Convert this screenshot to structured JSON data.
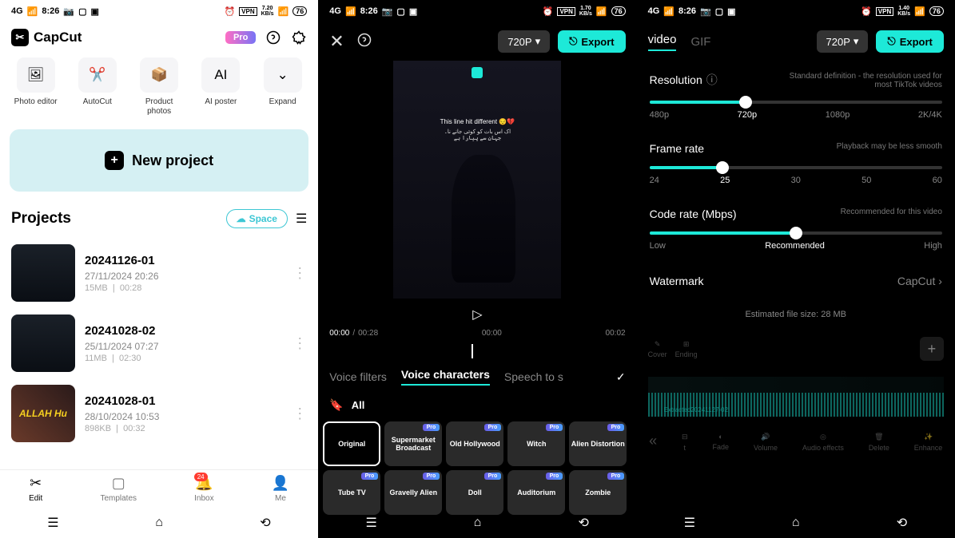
{
  "statusbar": {
    "time": "8:26",
    "signal": "4G",
    "speed1": "7.20",
    "speed2": "1.70",
    "speed3": "1.40",
    "unit": "KB/s",
    "batt": "76",
    "vpn": "VPN"
  },
  "s1": {
    "logo": "CapCut",
    "pro": "Pro",
    "tools": [
      "Photo editor",
      "AutoCut",
      "Product photos",
      "AI poster",
      "Expand"
    ],
    "newproject": "New project",
    "projectstitle": "Projects",
    "space": "Space",
    "projects": [
      {
        "t": "20241126-01",
        "d": "27/11/2024 20:26",
        "s": "15MB",
        "du": "00:28"
      },
      {
        "t": "20241028-02",
        "d": "25/11/2024 07:27",
        "s": "11MB",
        "du": "02:30"
      },
      {
        "t": "20241028-01",
        "d": "28/10/2024 10:53",
        "s": "898KB",
        "du": "00:32",
        "thumb": "ALLAH Hu"
      }
    ],
    "nav": [
      "Edit",
      "Templates",
      "Inbox",
      "Me"
    ],
    "badge": "24"
  },
  "s2": {
    "res": "720P",
    "export": "Export",
    "previewtext": "This line hit different 😔💔",
    "previewtext2": "اک اس بات کو کوئی جانے نا۔\nجہان سے پیارا ہے",
    "tTotal": "00:28",
    "tCur": "00:00",
    "t1": "00:00",
    "t2": "00:02",
    "tabs": [
      "Voice filters",
      "Voice characters",
      "Speech to s"
    ],
    "activetab": 1,
    "all": "All",
    "voices": [
      {
        "n": "Original",
        "sel": true
      },
      {
        "n": "Supermarket Broadcast",
        "pro": true
      },
      {
        "n": "Old Hollywood",
        "pro": true
      },
      {
        "n": "Witch",
        "pro": true
      },
      {
        "n": "Alien Distortion",
        "pro": true
      },
      {
        "n": "Tube TV",
        "pro": true
      },
      {
        "n": "Gravelly Alien",
        "pro": true
      },
      {
        "n": "Doll",
        "pro": true
      },
      {
        "n": "Auditorium",
        "pro": true
      },
      {
        "n": "Zombie",
        "pro": true
      }
    ]
  },
  "s3": {
    "tabvideo": "video",
    "tabgif": "GIF",
    "res": "720P",
    "export": "Export",
    "resolution": {
      "label": "Resolution",
      "desc": "Standard definition - the resolution used for most TikTok videos",
      "opts": [
        "480p",
        "720p",
        "1080p",
        "2K/4K"
      ],
      "pos": 33
    },
    "framerate": {
      "label": "Frame rate",
      "desc": "Playback may be less smooth",
      "opts": [
        "24",
        "25",
        "30",
        "50",
        "60"
      ],
      "pos": 25
    },
    "coderate": {
      "label": "Code rate (Mbps)",
      "desc": "Recommended for this video",
      "opts": [
        "Low",
        "Recommended",
        "High"
      ],
      "pos": 50
    },
    "watermark": "Watermark",
    "wmval": "CapCut",
    "estsize": "Estimated file size: 28 MB",
    "tltools": [
      "Cover",
      "Ending"
    ],
    "wavelabel": "Extracted20241127-02",
    "btools": [
      "t",
      "Fade",
      "Volume",
      "Audio effects",
      "Delete",
      "Enhance"
    ]
  }
}
